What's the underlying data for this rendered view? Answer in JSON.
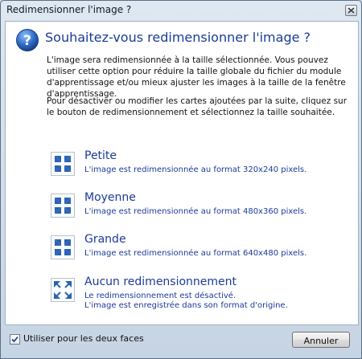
{
  "window": {
    "title": "Redimensionner l'image ?"
  },
  "dialog": {
    "heading": "Souhaitez-vous redimensionner l'image ?",
    "paragraph1": "L'image sera redimensionnée à la taille sélectionnée. Vous pouvez utiliser cette option pour réduire la taille globale du fichier du module d'apprentissage et/ou mieux ajuster les images à la taille de la fenêtre d'apprentissage.",
    "paragraph2": "Pour désactiver ou modifier les cartes ajoutées par la suite, cliquez sur le bouton de redimensionnement et sélectionnez la taille souhaitée."
  },
  "options": [
    {
      "title": "Petite",
      "desc_line1": "L'image est redimensionnée au format 320x240 pixels.",
      "desc_line2": "",
      "icon": "shrink-arrows-icon"
    },
    {
      "title": "Moyenne",
      "desc_line1": "L'image est redimensionnée au format 480x360 pixels.",
      "desc_line2": "",
      "icon": "shrink-arrows-icon"
    },
    {
      "title": "Grande",
      "desc_line1": "L'image est redimensionnée au format 640x480 pixels.",
      "desc_line2": "",
      "icon": "shrink-arrows-icon"
    },
    {
      "title": "Aucun redimensionnement",
      "desc_line1": "Le redimensionnement est désactivé.",
      "desc_line2": "L'image est enregistrée dans son format d'origine.",
      "icon": "expand-arrows-icon"
    }
  ],
  "footer": {
    "checkbox_label": "Utiliser pour les deux faces",
    "checkbox_checked": true,
    "cancel_label": "Annuler"
  },
  "colors": {
    "link_blue": "#1c3a9a",
    "heading_blue": "#1a3c96",
    "icon_blue": "#2b63b3"
  }
}
